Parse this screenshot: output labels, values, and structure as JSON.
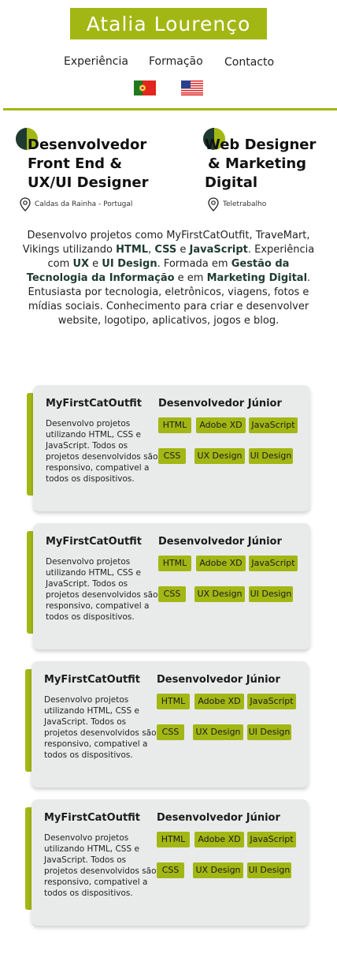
{
  "header": {
    "logo_text": "Atalia Lourenço"
  },
  "nav": {
    "items": [
      {
        "label": "Experiência"
      },
      {
        "label": "Formação"
      },
      {
        "label": "Contacto"
      }
    ],
    "languages": [
      {
        "name": "Português",
        "flag": "portugal-flag-icon"
      },
      {
        "name": "English",
        "flag": "usa-flag-icon"
      }
    ]
  },
  "colors": {
    "accent": "#a2b714",
    "dark_green": "#1f3a32",
    "card_bg": "#e9ebea"
  },
  "roles": [
    {
      "line1": "Desenvolvedor",
      "line2": "Front End &",
      "line3": "UX/UI Designer",
      "location": "Caldas da Rainha - Portugal"
    },
    {
      "line1": "Web Designer",
      "line2": "& Marketing",
      "line3": "Digital",
      "location": "Teletrabalho"
    }
  ],
  "intro": {
    "p1": "Desenvolvo projetos como MyFirstCatOutfit, TraveMart, Vikings utilizando ",
    "html": "HTML",
    "comma": ", ",
    "css": "CSS",
    "e1": " e ",
    "js": "JavaScript",
    "p2": ". Experiência com ",
    "ux": "UX",
    "e2": " e ",
    "ui": "UI Design",
    "p3": ". Formada em ",
    "gti": "Gestão da Tecnologia da Informação",
    "p4": " e em ",
    "md": "Marketing Digital",
    "p5": ". Entusiasta por tecnologia, eletrônicos, viagens, fotos e mídias sociais. Conhecimento para criar e desenvolver website, logotipo, aplicativos, jogos e blog."
  },
  "projects": [
    {
      "title": "MyFirstCatOutfit",
      "role": "Desenvolvedor Júnior",
      "description": "Desenvolvo projetos utilizando HTML, CSS e JavaScript. Todos os projetos desenvolvidos são responsivo, compativel a todos os dispositivos.",
      "tags": [
        "HTML",
        "Adobe XD",
        "JavaScript",
        "CSS",
        "UX Design",
        "UI Design"
      ]
    },
    {
      "title": "MyFirstCatOutfit",
      "role": "Desenvolvedor Júnior",
      "description": "Desenvolvo projetos utilizando HTML, CSS e JavaScript. Todos os projetos desenvolvidos são responsivo, compativel a todos os dispositivos.",
      "tags": [
        "HTML",
        "Adobe XD",
        "JavaScript",
        "CSS",
        "UX Design",
        "UI Design"
      ]
    },
    {
      "title": "MyFirstCatOutfit",
      "role": "Desenvolvedor Júnior",
      "description": "Desenvolvo projetos utilizando HTML, CSS e JavaScript. Todos os projetos desenvolvidos são responsivo, compativel a todos os dispositivos.",
      "tags": [
        "HTML",
        "Adobe XD",
        "JavaScript",
        "CSS",
        "UX Design",
        "UI Design"
      ]
    },
    {
      "title": "MyFirstCatOutfit",
      "role": "Desenvolvedor Júnior",
      "description": "Desenvolvo projetos utilizando HTML, CSS e JavaScript. Todos os projetos desenvolvidos são responsivo, compativel a todos os dispositivos.",
      "tags": [
        "HTML",
        "Adobe XD",
        "JavaScript",
        "CSS",
        "UX Design",
        "UI Design"
      ]
    }
  ]
}
